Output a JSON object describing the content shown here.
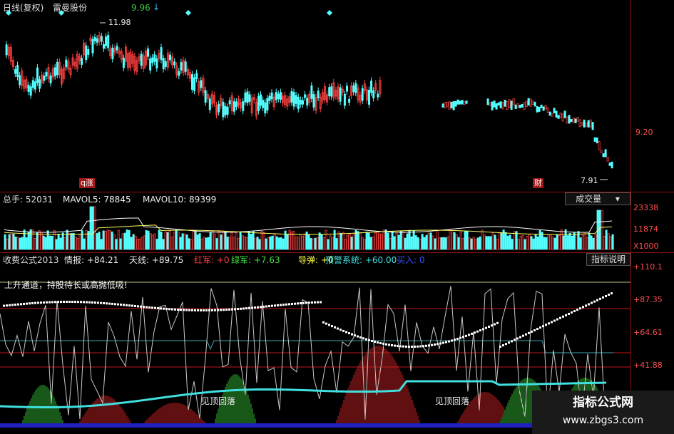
{
  "header": {
    "period_label": "日线(复权)",
    "stock_name": "雷曼股份",
    "price_marker": "9.96",
    "high_label": "11.98",
    "right_price": "9.20",
    "low_label": "7.91",
    "marker_left": "q涨",
    "marker_right": "财"
  },
  "volume": {
    "total_label": "总手: 52031",
    "mavol5_label": "MAVOL5: 78845",
    "mavol10_label": "MAVOL10: 89399",
    "dropdown_label": "成交量",
    "ticks": [
      "23338",
      "11874",
      "X1000"
    ]
  },
  "indicator": {
    "name": "收费公式2013",
    "intel_label": "情报: +84.21",
    "sky_label": "天线: +89.75",
    "red_label": "红军: +0",
    "green_label": "绿军: +7.63",
    "missile_label": "导弹: +0",
    "alert_label": "预警系统: +60.00",
    "buy_label": "买入: 0",
    "help_button": "指标说明",
    "notice": "上升通道，持股待长或高抛低吸!",
    "rebound_1": "见顶回落",
    "rebound_2": "见顶回落",
    "ticks": [
      "+110.1",
      "+87.35",
      "+64.61",
      "+41.88"
    ]
  },
  "watermark": {
    "title": "指标公式网",
    "url": "www.zbgs3.com"
  },
  "colors": {
    "up": "#ff4040",
    "down": "#54ffff",
    "red_line": "#c01818",
    "white": "#ffffff",
    "cyan": "#40e0e0",
    "green": "#40c040",
    "yellow": "#ffff40",
    "blue": "#2020c0"
  }
}
